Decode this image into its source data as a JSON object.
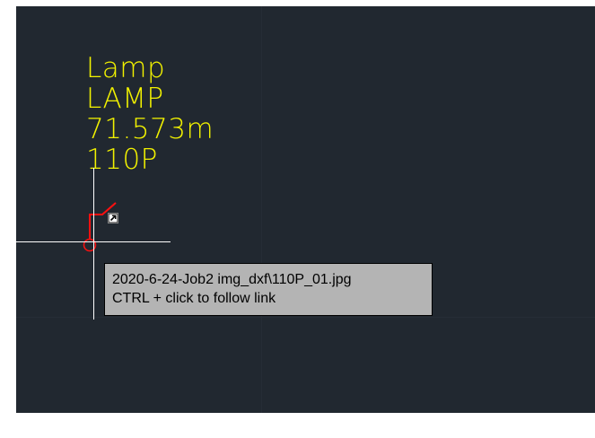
{
  "canvas": {
    "background_color": "#212830",
    "text_color": "#f2f200",
    "marker_color": "#ff1010",
    "crosshair_color": "#ffffff"
  },
  "entity_text": {
    "line1": "Lamp",
    "line2": "LAMP",
    "line3": "71.573m",
    "line4": "110P"
  },
  "link_icon": {
    "icon": "hyperlink-icon"
  },
  "tooltip": {
    "line1": "2020-6-24-Job2 img_dxf\\110P_01.jpg",
    "line2": "CTRL + click to follow link",
    "background_color": "#b4b4b4"
  }
}
